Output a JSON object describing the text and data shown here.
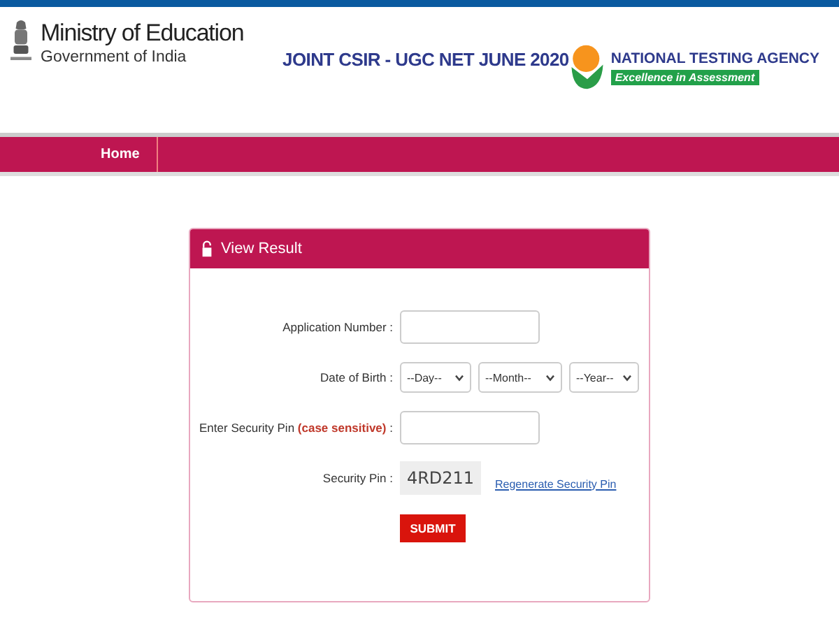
{
  "header": {
    "ministry": "Ministry of Education",
    "government": "Government of India",
    "exam_title": "JOINT CSIR - UGC NET JUNE 2020",
    "agency": "NATIONAL TESTING AGENCY",
    "agency_tagline": "Excellence in Assessment"
  },
  "nav": {
    "items": [
      {
        "label": "Home",
        "selected": true
      }
    ]
  },
  "form": {
    "title": "View Result",
    "application_label": "Application Number :",
    "dob_label": "Date of Birth :",
    "dob_selects": [
      "--Day--",
      "--Month--",
      "--Year--"
    ],
    "pin_label": "Enter Security Pin",
    "pin_label_note": "(case sensitive)",
    "pin_label_colon": ":",
    "captcha_label": "Security Pin :",
    "captcha": "4RD211",
    "regenerate": "Regenerate Security Pin",
    "submit": "SUBMIT"
  }
}
